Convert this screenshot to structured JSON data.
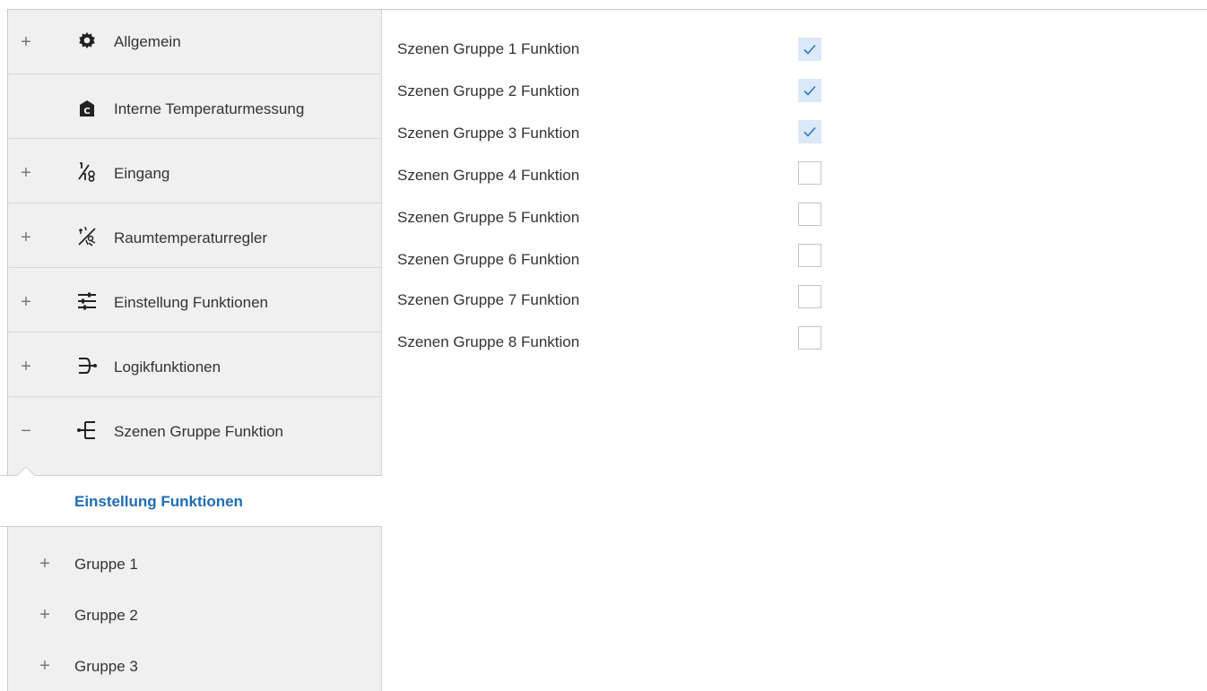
{
  "sidebar": {
    "items": [
      {
        "expander": "+",
        "icon": "gear-icon",
        "label": "Allgemein"
      },
      {
        "expander": "",
        "icon": "thermometer-box-icon",
        "label": "Interne Temperaturmessung"
      },
      {
        "expander": "+",
        "icon": "input-icon",
        "label": "Eingang"
      },
      {
        "expander": "+",
        "icon": "room-temperature-icon",
        "label": "Raumtemperaturregler"
      },
      {
        "expander": "+",
        "icon": "sliders-icon",
        "label": "Einstellung Funktionen"
      },
      {
        "expander": "+",
        "icon": "logic-icon",
        "label": "Logikfunktionen"
      },
      {
        "expander": "−",
        "icon": "scene-group-icon",
        "label": "Szenen Gruppe Funktion"
      }
    ],
    "sub_active": {
      "label": "Einstellung Funktionen"
    },
    "sub_items": [
      {
        "expander": "+",
        "label": "Gruppe 1"
      },
      {
        "expander": "+",
        "label": "Gruppe 2"
      },
      {
        "expander": "+",
        "label": "Gruppe 3"
      }
    ]
  },
  "settings": {
    "rows": [
      {
        "label": "Szenen Gruppe 1 Funktion",
        "checked": true
      },
      {
        "label": "Szenen Gruppe 2 Funktion",
        "checked": true
      },
      {
        "label": "Szenen Gruppe 3 Funktion",
        "checked": true
      },
      {
        "label": "Szenen Gruppe 4 Funktion",
        "checked": false
      },
      {
        "label": "Szenen Gruppe 5 Funktion",
        "checked": false
      },
      {
        "label": "Szenen Gruppe 6 Funktion",
        "checked": false
      },
      {
        "label": "Szenen Gruppe 7 Funktion",
        "checked": false
      },
      {
        "label": "Szenen Gruppe 8 Funktion",
        "checked": false
      }
    ]
  },
  "colors": {
    "accent": "#1f6db5",
    "checkbox_checked_bg": "#dbe8f8",
    "checkmark": "#2f74c8",
    "sidebar_bg": "#f0f0f0"
  }
}
